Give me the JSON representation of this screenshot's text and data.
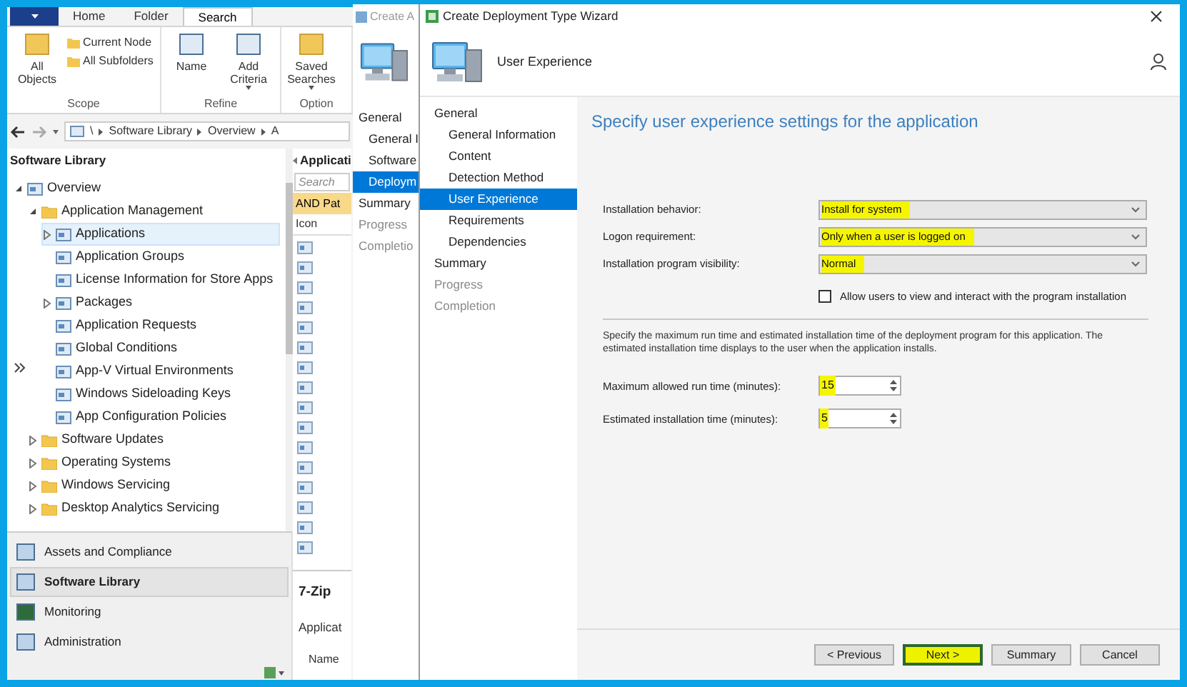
{
  "console": {
    "ribbon_tabs": [
      {
        "label": "Home",
        "selected": false
      },
      {
        "label": "Folder",
        "selected": false
      },
      {
        "label": "Search",
        "selected": true
      }
    ],
    "ribbon_groups": [
      {
        "label": "Scope",
        "buttons": [
          {
            "kind": "large",
            "label": "All Objects",
            "dropdown": false
          },
          {
            "kind": "small",
            "label": "Current Node",
            "dropdown": false
          },
          {
            "kind": "small",
            "label": "All Subfolders",
            "dropdown": false
          }
        ]
      },
      {
        "label": "Refine",
        "buttons": [
          {
            "kind": "large",
            "label": "Name",
            "dropdown": false
          },
          {
            "kind": "large",
            "label": "Add Criteria",
            "dropdown": true
          }
        ]
      },
      {
        "label": "Option",
        "buttons": [
          {
            "kind": "large",
            "label": "Saved Searches",
            "dropdown": true
          }
        ]
      }
    ],
    "breadcrumb": [
      "\\",
      "Software Library",
      "Overview",
      "A"
    ],
    "nav_title": "Software Library",
    "tree": [
      {
        "label": "Overview",
        "kind": "node",
        "expander": true,
        "expanded": true,
        "selected": false,
        "children": [
          {
            "label": "Application Management",
            "kind": "folder",
            "expander": true,
            "expanded": true,
            "selected": false,
            "children": [
              {
                "label": "Applications",
                "kind": "node",
                "expander": true,
                "expanded": false,
                "selected": true
              },
              {
                "label": "Application Groups",
                "kind": "node",
                "expander": false,
                "selected": false
              },
              {
                "label": "License Information for Store Apps",
                "kind": "node",
                "expander": false,
                "selected": false
              },
              {
                "label": "Packages",
                "kind": "node",
                "expander": true,
                "expanded": false,
                "selected": false
              },
              {
                "label": "Application Requests",
                "kind": "node",
                "expander": false,
                "selected": false
              },
              {
                "label": "Global Conditions",
                "kind": "node",
                "expander": false,
                "selected": false
              },
              {
                "label": "App-V Virtual Environments",
                "kind": "node",
                "expander": false,
                "selected": false
              },
              {
                "label": "Windows Sideloading Keys",
                "kind": "node",
                "expander": false,
                "selected": false
              },
              {
                "label": "App Configuration Policies",
                "kind": "node",
                "expander": false,
                "selected": false
              }
            ]
          },
          {
            "label": "Software Updates",
            "kind": "folder",
            "expander": true,
            "expanded": false,
            "selected": false
          },
          {
            "label": "Operating Systems",
            "kind": "folder",
            "expander": true,
            "expanded": false,
            "selected": false
          },
          {
            "label": "Windows Servicing",
            "kind": "folder",
            "expander": true,
            "expanded": false,
            "selected": false
          },
          {
            "label": "Desktop Analytics Servicing",
            "kind": "folder",
            "expander": true,
            "expanded": false,
            "selected": false
          }
        ]
      }
    ],
    "workspaces": [
      {
        "label": "Assets and Compliance",
        "selected": false
      },
      {
        "label": "Software Library",
        "selected": true
      },
      {
        "label": "Monitoring",
        "selected": false
      },
      {
        "label": "Administration",
        "selected": false
      }
    ],
    "list_pane": {
      "title": "Applicati",
      "search_placeholder": "Search",
      "filter": "AND Pat",
      "column": "Icon",
      "details_title": "7-Zip",
      "details_tab": "Applicat",
      "details_label": "Name"
    }
  },
  "back_wizard": {
    "title": "Create A",
    "nav": [
      {
        "label": "General",
        "selected": false,
        "disabled": false,
        "children": [
          {
            "label": "General I",
            "selected": false,
            "disabled": false
          },
          {
            "label": "Software",
            "selected": false,
            "disabled": false
          },
          {
            "label": "Deploym",
            "selected": true,
            "disabled": false
          }
        ]
      },
      {
        "label": "Summary",
        "selected": false,
        "disabled": false
      },
      {
        "label": "Progress",
        "selected": false,
        "disabled": true
      },
      {
        "label": "Completio",
        "selected": false,
        "disabled": true
      }
    ]
  },
  "wizard": {
    "title": "Create Deployment Type Wizard",
    "page_title": "User Experience",
    "nav": [
      {
        "label": "General",
        "selected": false,
        "disabled": false,
        "children": [
          {
            "label": "General Information",
            "selected": false,
            "disabled": false
          },
          {
            "label": "Content",
            "selected": false,
            "disabled": false
          },
          {
            "label": "Detection Method",
            "selected": false,
            "disabled": false
          },
          {
            "label": "User Experience",
            "selected": true,
            "disabled": false
          },
          {
            "label": "Requirements",
            "selected": false,
            "disabled": false
          },
          {
            "label": "Dependencies",
            "selected": false,
            "disabled": false
          }
        ]
      },
      {
        "label": "Summary",
        "selected": false,
        "disabled": false
      },
      {
        "label": "Progress",
        "selected": false,
        "disabled": true
      },
      {
        "label": "Completion",
        "selected": false,
        "disabled": true
      }
    ],
    "heading": "Specify user experience settings for the application",
    "fields": [
      {
        "label": "Installation behavior:",
        "value": "Install for system",
        "highlighted": true
      },
      {
        "label": "Logon requirement:",
        "value": "Only when a user is logged on",
        "highlighted": true
      },
      {
        "label": "Installation program visibility:",
        "value": "Normal",
        "highlighted": true
      }
    ],
    "checkbox": {
      "label": "Allow users to view and interact with the program installation",
      "checked": false
    },
    "description": "Specify the maximum run time and estimated installation time of the deployment program for this application.  The estimated installation time displays to the user when the application installs.",
    "spinners": [
      {
        "label": "Maximum allowed run time (minutes):",
        "value": "15",
        "highlighted": true
      },
      {
        "label": "Estimated installation time (minutes):",
        "value": "5",
        "highlighted": true
      }
    ],
    "buttons": [
      {
        "label": "< Previous",
        "highlighted": false
      },
      {
        "label": "Next >",
        "highlighted": true
      },
      {
        "label": "Summary",
        "highlighted": false
      },
      {
        "label": "Cancel",
        "highlighted": false
      }
    ]
  }
}
